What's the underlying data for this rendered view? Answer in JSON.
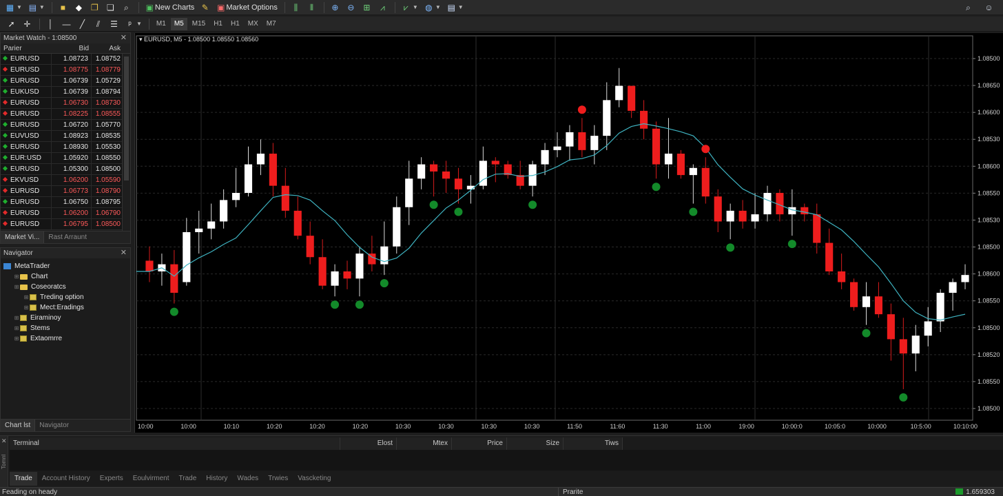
{
  "toolbar": {
    "new_charts_label": "New Charts",
    "market_options_label": "Market Options",
    "timeframes": [
      "M1",
      "M5",
      "M15",
      "H1",
      "H1",
      "MX",
      "M7"
    ],
    "active_timeframe": "M5"
  },
  "market_watch": {
    "title": "Market Watch - 1:08500",
    "columns": [
      "Parier",
      "Bid",
      "Ask"
    ],
    "rows": [
      {
        "symbol": "EURUSD",
        "bid": "1.08723",
        "ask": "1.08752",
        "dir": "up"
      },
      {
        "symbol": "EURUSD",
        "bid": "1.08775",
        "ask": "1.08779",
        "dir": "down"
      },
      {
        "symbol": "EURUSD",
        "bid": "1.06739",
        "ask": "1.05729",
        "dir": "up"
      },
      {
        "symbol": "EUKUSD",
        "bid": "1.06739",
        "ask": "1.08794",
        "dir": "up"
      },
      {
        "symbol": "EURUSD",
        "bid": "1.06730",
        "ask": "1.08730",
        "dir": "down"
      },
      {
        "symbol": "EURUSD",
        "bid": "1.08225",
        "ask": "1.08555",
        "dir": "down"
      },
      {
        "symbol": "EURUSD",
        "bid": "1.06720",
        "ask": "1.05770",
        "dir": "up"
      },
      {
        "symbol": "EUVUSD",
        "bid": "1.08923",
        "ask": "1.08535",
        "dir": "up"
      },
      {
        "symbol": "EURUSD",
        "bid": "1.08930",
        "ask": "1.05530",
        "dir": "up"
      },
      {
        "symbol": "EUR:USD",
        "bid": "1.05920",
        "ask": "1.08550",
        "dir": "up"
      },
      {
        "symbol": "EURUSD",
        "bid": "1.05300",
        "ask": "1.08500",
        "dir": "up"
      },
      {
        "symbol": "EKVUSD",
        "bid": "1.06200",
        "ask": "1.05590",
        "dir": "down"
      },
      {
        "symbol": "EURUSD",
        "bid": "1.06773",
        "ask": "1.08790",
        "dir": "down"
      },
      {
        "symbol": "EURUSD",
        "bid": "1.06750",
        "ask": "1.08795",
        "dir": "up"
      },
      {
        "symbol": "EURUSD",
        "bid": "1.06200",
        "ask": "1.06790",
        "dir": "down"
      },
      {
        "symbol": "EURUSD",
        "bid": "1.06795",
        "ask": "1.08500",
        "dir": "down"
      }
    ],
    "tabs": [
      "Market Vi...",
      "Rast Arraunt"
    ]
  },
  "navigator": {
    "title": "Navigator",
    "items": [
      {
        "label": "MetaTrader",
        "level": 0,
        "kind": "root"
      },
      {
        "label": "Chart",
        "level": 1,
        "kind": "folder"
      },
      {
        "label": "Coseoratcs",
        "level": 1,
        "kind": "folder"
      },
      {
        "label": "Treding option",
        "level": 2,
        "kind": "leaf"
      },
      {
        "label": "Mect:Eradings",
        "level": 2,
        "kind": "leaf"
      },
      {
        "label": "Eiraminoy",
        "level": 1,
        "kind": "leaf"
      },
      {
        "label": "Stems",
        "level": 1,
        "kind": "leaf"
      },
      {
        "label": "Extaomrre",
        "level": 1,
        "kind": "leaf"
      }
    ],
    "tabs": [
      "Chart lst",
      "Navigator"
    ]
  },
  "chart": {
    "title": "EURUSD, M5 - 1.08500 1.08550 1.08560"
  },
  "chart_data": {
    "type": "candlestick",
    "title": "EURUSD, M5 - 1.08500 1.08550 1.08560",
    "y_tick_labels": [
      "1.08500",
      "1.08650",
      "1.06600",
      "1.08530",
      "1.08600",
      "1.08550",
      "1.08530",
      "1.08500",
      "1.08600",
      "1.08550",
      "1.08500",
      "1.08520",
      "1.08550",
      "1.08500"
    ],
    "x_tick_labels": [
      "10:00",
      "10:00",
      "10:10",
      "10:20",
      "10:20",
      "10:20",
      "10:30",
      "10:30",
      "10:30",
      "10:30",
      "11:50",
      "11:60",
      "11:30",
      "11:00",
      "19:00",
      "10:00:0",
      "10:05:0",
      "10:000",
      "10:5:00",
      "10:10:00"
    ],
    "candles": [
      {
        "o": 0.42,
        "h": 0.46,
        "l": 0.36,
        "c": 0.39
      },
      {
        "o": 0.39,
        "h": 0.44,
        "l": 0.35,
        "c": 0.41
      },
      {
        "o": 0.41,
        "h": 0.45,
        "l": 0.3,
        "c": 0.33
      },
      {
        "o": 0.36,
        "h": 0.54,
        "l": 0.35,
        "c": 0.5
      },
      {
        "o": 0.5,
        "h": 0.56,
        "l": 0.44,
        "c": 0.51
      },
      {
        "o": 0.51,
        "h": 0.58,
        "l": 0.48,
        "c": 0.53
      },
      {
        "o": 0.53,
        "h": 0.62,
        "l": 0.51,
        "c": 0.59
      },
      {
        "o": 0.59,
        "h": 0.68,
        "l": 0.57,
        "c": 0.61
      },
      {
        "o": 0.61,
        "h": 0.74,
        "l": 0.6,
        "c": 0.69
      },
      {
        "o": 0.69,
        "h": 0.76,
        "l": 0.66,
        "c": 0.72
      },
      {
        "o": 0.72,
        "h": 0.75,
        "l": 0.6,
        "c": 0.63
      },
      {
        "o": 0.63,
        "h": 0.68,
        "l": 0.54,
        "c": 0.56
      },
      {
        "o": 0.56,
        "h": 0.6,
        "l": 0.48,
        "c": 0.49
      },
      {
        "o": 0.49,
        "h": 0.53,
        "l": 0.41,
        "c": 0.43
      },
      {
        "o": 0.43,
        "h": 0.48,
        "l": 0.34,
        "c": 0.35
      },
      {
        "o": 0.35,
        "h": 0.41,
        "l": 0.32,
        "c": 0.39
      },
      {
        "o": 0.39,
        "h": 0.42,
        "l": 0.34,
        "c": 0.37
      },
      {
        "o": 0.37,
        "h": 0.46,
        "l": 0.32,
        "c": 0.44
      },
      {
        "o": 0.44,
        "h": 0.49,
        "l": 0.39,
        "c": 0.41
      },
      {
        "o": 0.41,
        "h": 0.53,
        "l": 0.38,
        "c": 0.46
      },
      {
        "o": 0.46,
        "h": 0.6,
        "l": 0.44,
        "c": 0.57
      },
      {
        "o": 0.57,
        "h": 0.7,
        "l": 0.52,
        "c": 0.65
      },
      {
        "o": 0.65,
        "h": 0.71,
        "l": 0.62,
        "c": 0.69
      },
      {
        "o": 0.69,
        "h": 0.7,
        "l": 0.6,
        "c": 0.67
      },
      {
        "o": 0.67,
        "h": 0.7,
        "l": 0.61,
        "c": 0.65
      },
      {
        "o": 0.65,
        "h": 0.68,
        "l": 0.58,
        "c": 0.62
      },
      {
        "o": 0.62,
        "h": 0.66,
        "l": 0.58,
        "c": 0.63
      },
      {
        "o": 0.63,
        "h": 0.74,
        "l": 0.62,
        "c": 0.7
      },
      {
        "o": 0.7,
        "h": 0.71,
        "l": 0.64,
        "c": 0.69
      },
      {
        "o": 0.69,
        "h": 0.7,
        "l": 0.65,
        "c": 0.66
      },
      {
        "o": 0.66,
        "h": 0.7,
        "l": 0.62,
        "c": 0.63
      },
      {
        "o": 0.63,
        "h": 0.7,
        "l": 0.6,
        "c": 0.69
      },
      {
        "o": 0.69,
        "h": 0.75,
        "l": 0.66,
        "c": 0.73
      },
      {
        "o": 0.73,
        "h": 0.78,
        "l": 0.71,
        "c": 0.74
      },
      {
        "o": 0.74,
        "h": 0.8,
        "l": 0.7,
        "c": 0.78
      },
      {
        "o": 0.78,
        "h": 0.82,
        "l": 0.71,
        "c": 0.73
      },
      {
        "o": 0.73,
        "h": 0.8,
        "l": 0.69,
        "c": 0.77
      },
      {
        "o": 0.77,
        "h": 0.92,
        "l": 0.73,
        "c": 0.87
      },
      {
        "o": 0.87,
        "h": 0.96,
        "l": 0.85,
        "c": 0.91
      },
      {
        "o": 0.91,
        "h": 0.91,
        "l": 0.82,
        "c": 0.84
      },
      {
        "o": 0.84,
        "h": 0.87,
        "l": 0.76,
        "c": 0.79
      },
      {
        "o": 0.79,
        "h": 0.81,
        "l": 0.65,
        "c": 0.69
      },
      {
        "o": 0.69,
        "h": 0.82,
        "l": 0.65,
        "c": 0.72
      },
      {
        "o": 0.72,
        "h": 0.73,
        "l": 0.65,
        "c": 0.66
      },
      {
        "o": 0.66,
        "h": 0.69,
        "l": 0.58,
        "c": 0.68
      },
      {
        "o": 0.68,
        "h": 0.71,
        "l": 0.58,
        "c": 0.6
      },
      {
        "o": 0.6,
        "h": 0.62,
        "l": 0.5,
        "c": 0.53
      },
      {
        "o": 0.53,
        "h": 0.58,
        "l": 0.48,
        "c": 0.56
      },
      {
        "o": 0.56,
        "h": 0.59,
        "l": 0.51,
        "c": 0.53
      },
      {
        "o": 0.53,
        "h": 0.61,
        "l": 0.51,
        "c": 0.55
      },
      {
        "o": 0.55,
        "h": 0.63,
        "l": 0.53,
        "c": 0.61
      },
      {
        "o": 0.61,
        "h": 0.62,
        "l": 0.53,
        "c": 0.55
      },
      {
        "o": 0.55,
        "h": 0.62,
        "l": 0.49,
        "c": 0.57
      },
      {
        "o": 0.57,
        "h": 0.58,
        "l": 0.53,
        "c": 0.55
      },
      {
        "o": 0.55,
        "h": 0.58,
        "l": 0.44,
        "c": 0.47
      },
      {
        "o": 0.47,
        "h": 0.51,
        "l": 0.38,
        "c": 0.39
      },
      {
        "o": 0.39,
        "h": 0.44,
        "l": 0.34,
        "c": 0.36
      },
      {
        "o": 0.36,
        "h": 0.37,
        "l": 0.28,
        "c": 0.29
      },
      {
        "o": 0.29,
        "h": 0.36,
        "l": 0.24,
        "c": 0.32
      },
      {
        "o": 0.32,
        "h": 0.36,
        "l": 0.26,
        "c": 0.27
      },
      {
        "o": 0.27,
        "h": 0.3,
        "l": 0.14,
        "c": 0.2
      },
      {
        "o": 0.2,
        "h": 0.26,
        "l": 0.06,
        "c": 0.16
      },
      {
        "o": 0.16,
        "h": 0.24,
        "l": 0.11,
        "c": 0.21
      },
      {
        "o": 0.21,
        "h": 0.29,
        "l": 0.18,
        "c": 0.25
      },
      {
        "o": 0.25,
        "h": 0.34,
        "l": 0.22,
        "c": 0.33
      },
      {
        "o": 0.33,
        "h": 0.37,
        "l": 0.28,
        "c": 0.36
      },
      {
        "o": 0.36,
        "h": 0.41,
        "l": 0.34,
        "c": 0.38
      }
    ],
    "ma_color": "#3fb4c2",
    "up_color": "#ffffff",
    "down_color": "#ee1d1d",
    "buy_signal_color": "#138a2a",
    "sell_signal_color": "#ee1d1d"
  },
  "terminal": {
    "columns": [
      "",
      "Elost",
      "Mtex",
      "Price",
      "Size",
      "Tiws"
    ],
    "name_header": "Terminal",
    "tabs": [
      "Trade",
      "Account History",
      "Experts",
      "Eoulvirment",
      "Trade",
      "History",
      "Wades",
      "Trwies",
      "Vascketing"
    ],
    "active_tab": "Trade",
    "side_label": "Tomnl"
  },
  "status": {
    "left": "Feading on heady",
    "middle": "Prarite",
    "right": "1.659303"
  }
}
